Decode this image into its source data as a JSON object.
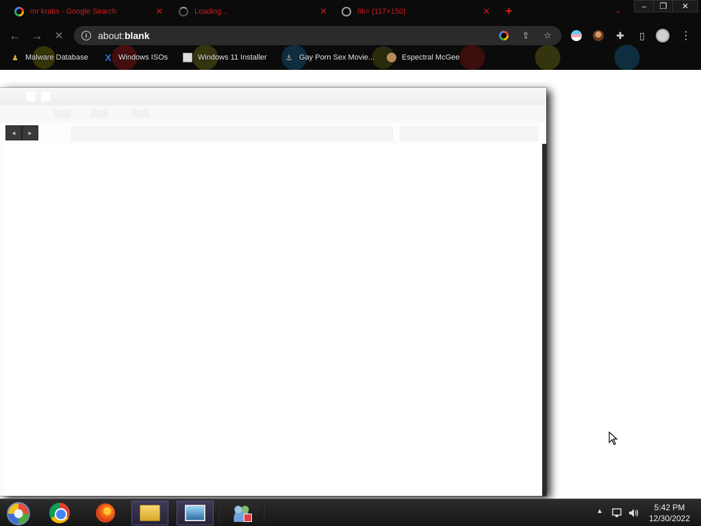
{
  "tabs": [
    {
      "title": "mr krabs - Google Search",
      "favicon": "google-icon",
      "close": "✕"
    },
    {
      "title": "Loading...",
      "favicon": "spinner-icon",
      "close": "✕"
    },
    {
      "title": "9k= (117×150)",
      "favicon": "globe-icon",
      "close": "✕"
    }
  ],
  "tabstrip": {
    "new_tab": "+",
    "tab_search": "⌄",
    "minimize": "–",
    "restore": "❐",
    "close": "✕"
  },
  "toolbar": {
    "back": "←",
    "forward": "→",
    "stop": "✕",
    "info": "i",
    "url_prefix": "about:",
    "url_host": "blank"
  },
  "bookmarks": [
    {
      "label": "Malware Database",
      "icon": "figure-icon"
    },
    {
      "label": "Windows ISOs",
      "icon": "x-icon"
    },
    {
      "label": "Windows 11 Installer",
      "icon": "page-icon"
    },
    {
      "label": "Gay Porn Sex Movie...",
      "icon": "ship-icon"
    },
    {
      "label": "Espectral McGee",
      "icon": "avatar-icon"
    }
  ],
  "ghost_window": {
    "back": "◄",
    "forward": "►"
  },
  "taskbar": {
    "time": "5:42 PM",
    "date": "12/30/2022",
    "tray_arrow": "▲"
  },
  "colors": {
    "tab_text": "#d01c1c",
    "taskbar_bg": "#1e1e1e",
    "chrome_bg": "#0b0b0b"
  }
}
